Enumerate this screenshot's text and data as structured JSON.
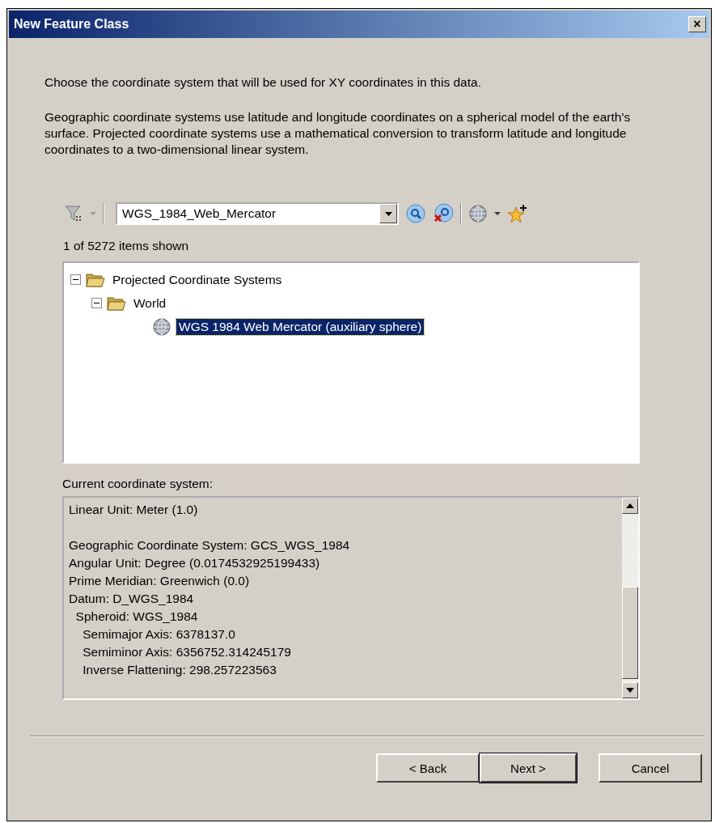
{
  "window": {
    "title": "New Feature Class",
    "close": "×"
  },
  "intro": "Choose the coordinate system that will be used for XY coordinates in this data.",
  "description": "Geographic coordinate systems use latitude and longitude coordinates on a spherical model of the earth's surface. Projected coordinate systems use a mathematical conversion to transform latitude and longitude coordinates to a two-dimensional linear system.",
  "search": {
    "value": "WGS_1984_Web_Mercator"
  },
  "count": "1 of 5272 items shown",
  "tree": [
    {
      "kind": "folder",
      "label": "Projected Coordinate Systems",
      "expanded": true,
      "selected": false,
      "children": [
        {
          "kind": "folder",
          "label": "World",
          "expanded": true,
          "selected": false,
          "children": [
            {
              "kind": "system",
              "label": "WGS 1984 Web Mercator (auxiliary sphere)",
              "selected": true
            }
          ]
        }
      ]
    }
  ],
  "details": {
    "label": "Current coordinate system:",
    "blocks": [
      [
        "Linear Unit: Meter (1.0)"
      ],
      [
        "Geographic Coordinate System: GCS_WGS_1984",
        "Angular Unit: Degree (0.0174532925199433)",
        "Prime Meridian: Greenwich (0.0)",
        "Datum: D_WGS_1984",
        "  Spheroid: WGS_1984",
        "    Semimajor Axis: 6378137.0",
        "    Semiminor Axis: 6356752.314245179",
        "    Inverse Flattening: 298.257223563"
      ]
    ]
  },
  "buttons": [
    {
      "label": "< Back",
      "default": false
    },
    {
      "label": "Next >",
      "default": true
    },
    {
      "label": "Cancel",
      "default": false
    }
  ]
}
